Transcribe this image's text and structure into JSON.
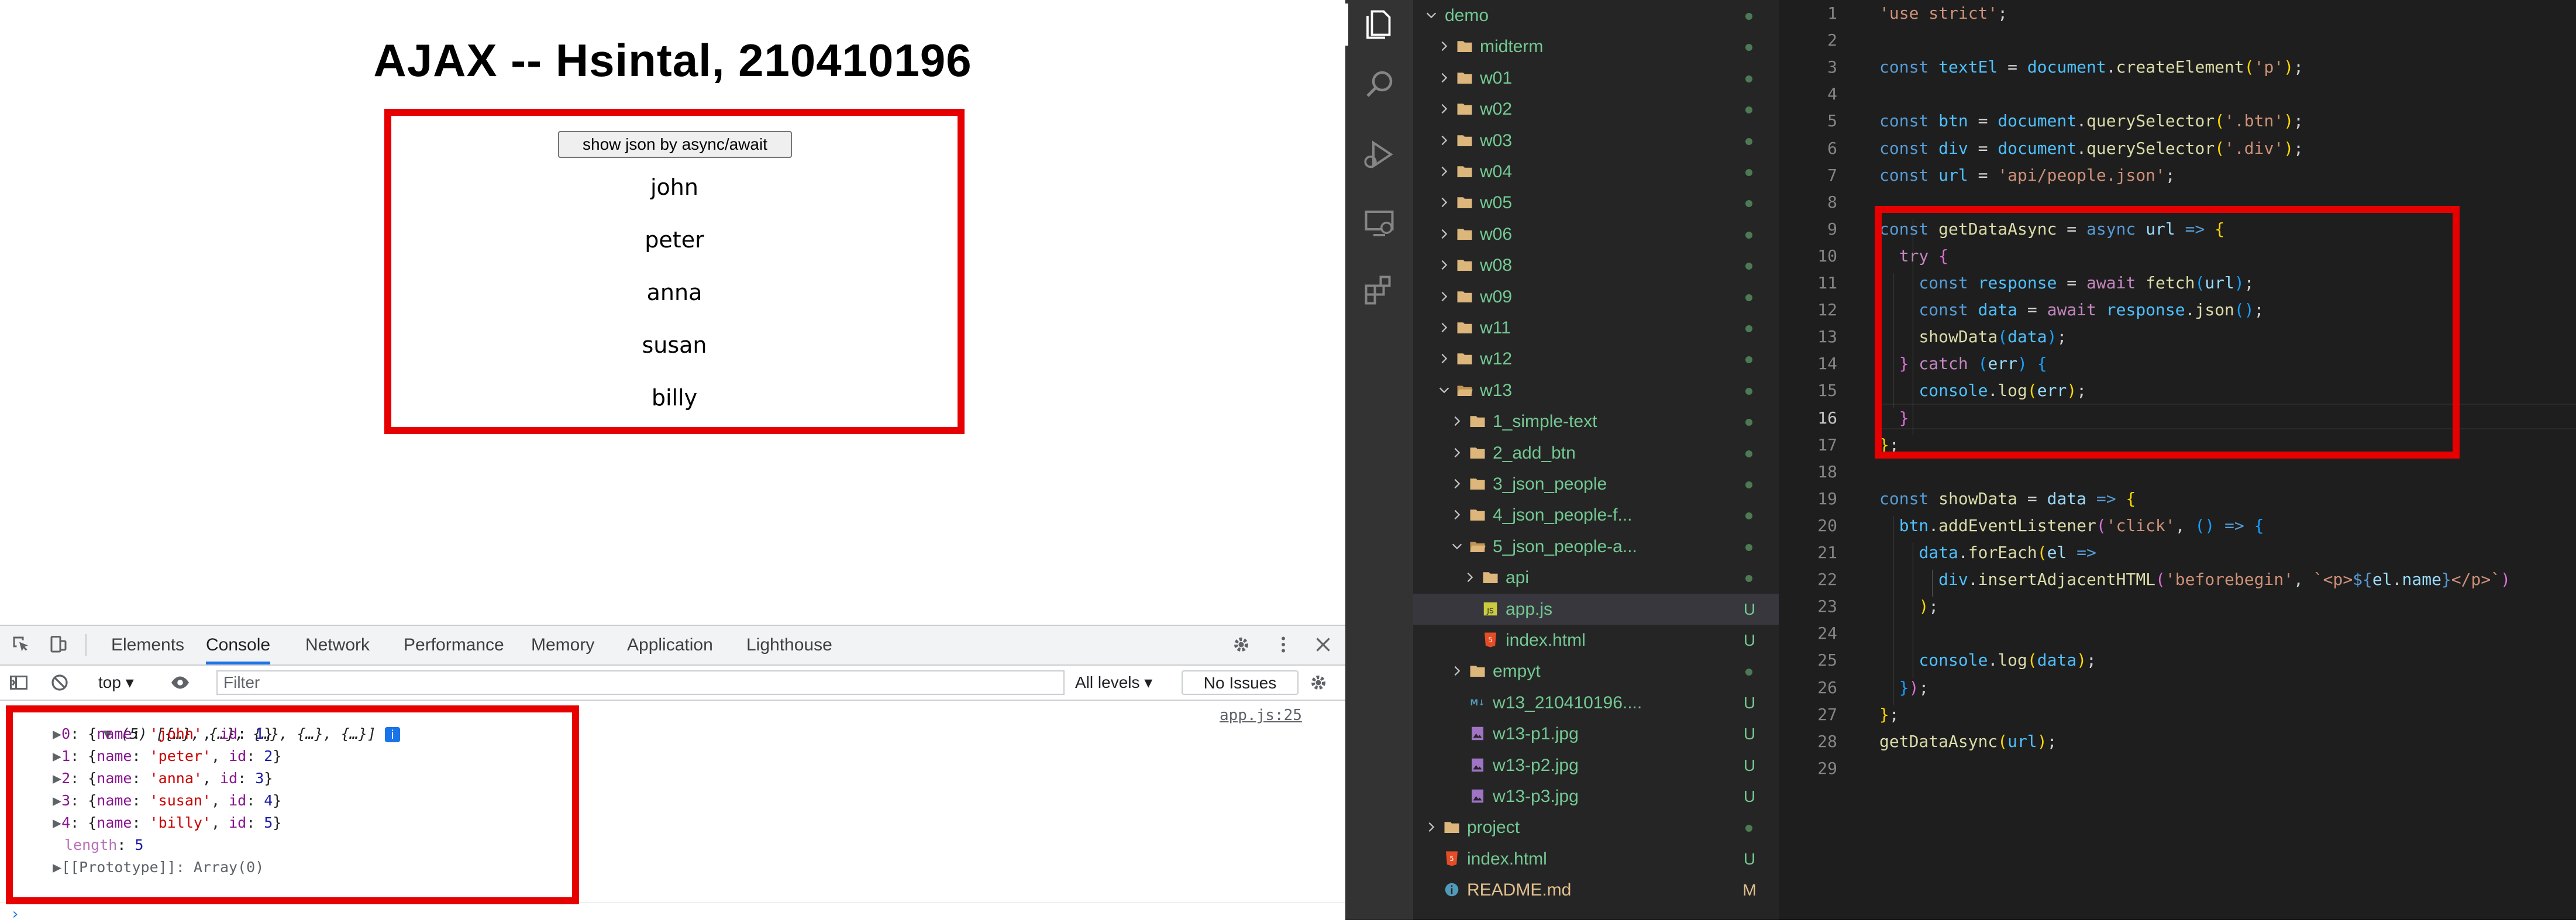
{
  "browser": {
    "page": {
      "title": "AJAX -- Hsintal, 210410196",
      "button_label": "show json by async/await",
      "names": [
        "john",
        "peter",
        "anna",
        "susan",
        "billy"
      ]
    },
    "devtools": {
      "tabs": [
        "Elements",
        "Console",
        "Network",
        "Performance",
        "Memory",
        "Application",
        "Lighthouse"
      ],
      "active_tab": "Console",
      "context": "top",
      "filter_placeholder": "Filter",
      "levels": "All levels",
      "issues": "No Issues",
      "source_link": "app.js:25",
      "console": {
        "summary": "(5) [{…}, {…}, {…}, {…}, {…}]",
        "entries": [
          {
            "index": "0",
            "name": "'john'",
            "id": "1"
          },
          {
            "index": "1",
            "name": "'peter'",
            "id": "2"
          },
          {
            "index": "2",
            "name": "'anna'",
            "id": "3"
          },
          {
            "index": "3",
            "name": "'susan'",
            "id": "4"
          },
          {
            "index": "4",
            "name": "'billy'",
            "id": "5"
          }
        ],
        "length_key": "length",
        "length_value": "5",
        "prototype": "[[Prototype]]: Array(0)"
      }
    }
  },
  "vscode": {
    "explorer": {
      "items": [
        {
          "label": "demo",
          "kind": "folder",
          "open": true,
          "badge": "dot"
        },
        {
          "label": "midterm",
          "kind": "folder",
          "open": false,
          "badge": "dot"
        },
        {
          "label": "w01",
          "kind": "folder",
          "open": false,
          "badge": "dot"
        },
        {
          "label": "w02",
          "kind": "folder",
          "open": false,
          "badge": "dot"
        },
        {
          "label": "w03",
          "kind": "folder",
          "open": false,
          "badge": "dot"
        },
        {
          "label": "w04",
          "kind": "folder",
          "open": false,
          "badge": "dot"
        },
        {
          "label": "w05",
          "kind": "folder",
          "open": false,
          "badge": "dot"
        },
        {
          "label": "w06",
          "kind": "folder",
          "open": false,
          "badge": "dot"
        },
        {
          "label": "w08",
          "kind": "folder",
          "open": false,
          "badge": "dot"
        },
        {
          "label": "w09",
          "kind": "folder",
          "open": false,
          "badge": "dot"
        },
        {
          "label": "w11",
          "kind": "folder",
          "open": false,
          "badge": "dot"
        },
        {
          "label": "w12",
          "kind": "folder",
          "open": false,
          "badge": "dot"
        },
        {
          "label": "w13",
          "kind": "folder",
          "open": true,
          "badge": "dot"
        },
        {
          "label": "1_simple-text",
          "kind": "folder",
          "open": false,
          "badge": "dot"
        },
        {
          "label": "2_add_btn",
          "kind": "folder",
          "open": false,
          "badge": "dot"
        },
        {
          "label": "3_json_people",
          "kind": "folder",
          "open": false,
          "badge": "dot"
        },
        {
          "label": "4_json_people-f...",
          "kind": "folder",
          "open": false,
          "badge": "dot"
        },
        {
          "label": "5_json_people-a...",
          "kind": "folder",
          "open": true,
          "badge": "dot"
        },
        {
          "label": "api",
          "kind": "folder",
          "open": false,
          "badge": "dot"
        },
        {
          "label": "app.js",
          "kind": "js",
          "badge": "U",
          "selected": true
        },
        {
          "label": "index.html",
          "kind": "html",
          "badge": "U"
        },
        {
          "label": "empyt",
          "kind": "folder",
          "open": false,
          "badge": "dot"
        },
        {
          "label": "w13_210410196....",
          "kind": "md",
          "badge": "U"
        },
        {
          "label": "w13-p1.jpg",
          "kind": "img",
          "badge": "U"
        },
        {
          "label": "w13-p2.jpg",
          "kind": "img",
          "badge": "U"
        },
        {
          "label": "w13-p3.jpg",
          "kind": "img",
          "badge": "U"
        },
        {
          "label": "project",
          "kind": "folder",
          "open": false,
          "badge": "dot"
        },
        {
          "label": "index.html",
          "kind": "html",
          "badge": "U"
        },
        {
          "label": "README.md",
          "kind": "info",
          "badge": "M"
        }
      ]
    },
    "editor": {
      "active_line": 16,
      "lines": [
        [
          [
            "t-str",
            "'use strict'"
          ],
          [
            "t-pun",
            ";"
          ]
        ],
        [],
        [
          [
            "t-kw",
            "const "
          ],
          [
            "t-var",
            "textEl"
          ],
          [
            "t-pun",
            " = "
          ],
          [
            "t-var",
            "document"
          ],
          [
            "t-pun",
            "."
          ],
          [
            "t-fn",
            "createElement"
          ],
          [
            "t-b1",
            "("
          ],
          [
            "t-str",
            "'p'"
          ],
          [
            "t-b1",
            ")"
          ],
          [
            "t-pun",
            ";"
          ]
        ],
        [],
        [
          [
            "t-kw",
            "const "
          ],
          [
            "t-var",
            "btn"
          ],
          [
            "t-pun",
            " = "
          ],
          [
            "t-var",
            "document"
          ],
          [
            "t-pun",
            "."
          ],
          [
            "t-fn",
            "querySelector"
          ],
          [
            "t-b1",
            "("
          ],
          [
            "t-str",
            "'.btn'"
          ],
          [
            "t-b1",
            ")"
          ],
          [
            "t-pun",
            ";"
          ]
        ],
        [
          [
            "t-kw",
            "const "
          ],
          [
            "t-var",
            "div"
          ],
          [
            "t-pun",
            " = "
          ],
          [
            "t-var",
            "document"
          ],
          [
            "t-pun",
            "."
          ],
          [
            "t-fn",
            "querySelector"
          ],
          [
            "t-b1",
            "("
          ],
          [
            "t-str",
            "'.div'"
          ],
          [
            "t-b1",
            ")"
          ],
          [
            "t-pun",
            ";"
          ]
        ],
        [
          [
            "t-kw",
            "const "
          ],
          [
            "t-var",
            "url"
          ],
          [
            "t-pun",
            " = "
          ],
          [
            "t-str",
            "'api/people.json'"
          ],
          [
            "t-pun",
            ";"
          ]
        ],
        [],
        [
          [
            "t-kw",
            "const "
          ],
          [
            "t-fn",
            "getDataAsync"
          ],
          [
            "t-pun",
            " = "
          ],
          [
            "t-kw",
            "async "
          ],
          [
            "t-id",
            "url"
          ],
          [
            "t-kw",
            " => "
          ],
          [
            "t-b1",
            "{"
          ]
        ],
        [
          [
            "t-pun",
            "  "
          ],
          [
            "t-ctl",
            "try "
          ],
          [
            "t-b2",
            "{"
          ]
        ],
        [
          [
            "t-pun",
            "    "
          ],
          [
            "t-kw",
            "const "
          ],
          [
            "t-var",
            "response"
          ],
          [
            "t-pun",
            " = "
          ],
          [
            "t-ctl",
            "await "
          ],
          [
            "t-fn",
            "fetch"
          ],
          [
            "t-b3",
            "("
          ],
          [
            "t-id",
            "url"
          ],
          [
            "t-b3",
            ")"
          ],
          [
            "t-pun",
            ";"
          ]
        ],
        [
          [
            "t-pun",
            "    "
          ],
          [
            "t-kw",
            "const "
          ],
          [
            "t-var",
            "data"
          ],
          [
            "t-pun",
            " = "
          ],
          [
            "t-ctl",
            "await "
          ],
          [
            "t-var",
            "response"
          ],
          [
            "t-pun",
            "."
          ],
          [
            "t-fn",
            "json"
          ],
          [
            "t-b3",
            "()"
          ],
          [
            "t-pun",
            ";"
          ]
        ],
        [
          [
            "t-pun",
            "    "
          ],
          [
            "t-fn",
            "showData"
          ],
          [
            "t-b3",
            "("
          ],
          [
            "t-var",
            "data"
          ],
          [
            "t-b3",
            ")"
          ],
          [
            "t-pun",
            ";"
          ]
        ],
        [
          [
            "t-pun",
            "  "
          ],
          [
            "t-b2",
            "}"
          ],
          [
            "t-ctl",
            " catch "
          ],
          [
            "t-b3",
            "("
          ],
          [
            "t-id",
            "err"
          ],
          [
            "t-b3",
            ")"
          ],
          [
            "t-pun",
            " "
          ],
          [
            "t-b3",
            "{"
          ]
        ],
        [
          [
            "t-pun",
            "    "
          ],
          [
            "t-var",
            "console"
          ],
          [
            "t-pun",
            "."
          ],
          [
            "t-fn",
            "log"
          ],
          [
            "t-b1",
            "("
          ],
          [
            "t-id",
            "err"
          ],
          [
            "t-b1",
            ")"
          ],
          [
            "t-pun",
            ";"
          ]
        ],
        [
          [
            "t-pun",
            "  "
          ],
          [
            "t-b2",
            "}"
          ]
        ],
        [
          [
            "t-b1",
            "}"
          ],
          [
            "t-pun",
            ";"
          ]
        ],
        [],
        [
          [
            "t-kw",
            "const "
          ],
          [
            "t-fn",
            "showData"
          ],
          [
            "t-pun",
            " = "
          ],
          [
            "t-id",
            "data"
          ],
          [
            "t-kw",
            " => "
          ],
          [
            "t-b1",
            "{"
          ]
        ],
        [
          [
            "t-pun",
            "  "
          ],
          [
            "t-var",
            "btn"
          ],
          [
            "t-pun",
            "."
          ],
          [
            "t-fn",
            "addEventListener"
          ],
          [
            "t-b2",
            "("
          ],
          [
            "t-str",
            "'click'"
          ],
          [
            "t-pun",
            ", "
          ],
          [
            "t-b3",
            "()"
          ],
          [
            "t-kw",
            " => "
          ],
          [
            "t-b3",
            "{"
          ]
        ],
        [
          [
            "t-pun",
            "    "
          ],
          [
            "t-var",
            "data"
          ],
          [
            "t-pun",
            "."
          ],
          [
            "t-fn",
            "forEach"
          ],
          [
            "t-b1",
            "("
          ],
          [
            "t-id",
            "el"
          ],
          [
            "t-kw",
            " =>"
          ]
        ],
        [
          [
            "t-pun",
            "      "
          ],
          [
            "t-var",
            "div"
          ],
          [
            "t-pun",
            "."
          ],
          [
            "t-fn",
            "insertAdjacentHTML"
          ],
          [
            "t-b2",
            "("
          ],
          [
            "t-str",
            "'beforebegin'"
          ],
          [
            "t-pun",
            ", "
          ],
          [
            "t-str",
            "`<p>"
          ],
          [
            "t-kw",
            "${"
          ],
          [
            "t-id",
            "el"
          ],
          [
            "t-pun",
            "."
          ],
          [
            "t-id",
            "name"
          ],
          [
            "t-kw",
            "}"
          ],
          [
            "t-str",
            "</p>`"
          ],
          [
            "t-b2",
            ")"
          ]
        ],
        [
          [
            "t-pun",
            "    "
          ],
          [
            "t-b1",
            ")"
          ],
          [
            "t-pun",
            ";"
          ]
        ],
        [],
        [
          [
            "t-pun",
            "    "
          ],
          [
            "t-var",
            "console"
          ],
          [
            "t-pun",
            "."
          ],
          [
            "t-fn",
            "log"
          ],
          [
            "t-b1",
            "("
          ],
          [
            "t-var",
            "data"
          ],
          [
            "t-b1",
            ")"
          ],
          [
            "t-pun",
            ";"
          ]
        ],
        [
          [
            "t-pun",
            "  "
          ],
          [
            "t-b3",
            "}"
          ],
          [
            "t-b2",
            ")"
          ],
          [
            "t-pun",
            ";"
          ]
        ],
        [
          [
            "t-b1",
            "}"
          ],
          [
            "t-pun",
            ";"
          ]
        ],
        [
          [
            "t-fn",
            "getDataAsync"
          ],
          [
            "t-b1",
            "("
          ],
          [
            "t-var",
            "url"
          ],
          [
            "t-b1",
            ")"
          ],
          [
            "t-pun",
            ";"
          ]
        ],
        []
      ]
    }
  },
  "colors": {
    "highlight_border": "#e60000",
    "vscode_bg": "#1e1e1e",
    "explorer_bg": "#252526",
    "untracked": "#73c991",
    "modified": "#e2c08d"
  }
}
